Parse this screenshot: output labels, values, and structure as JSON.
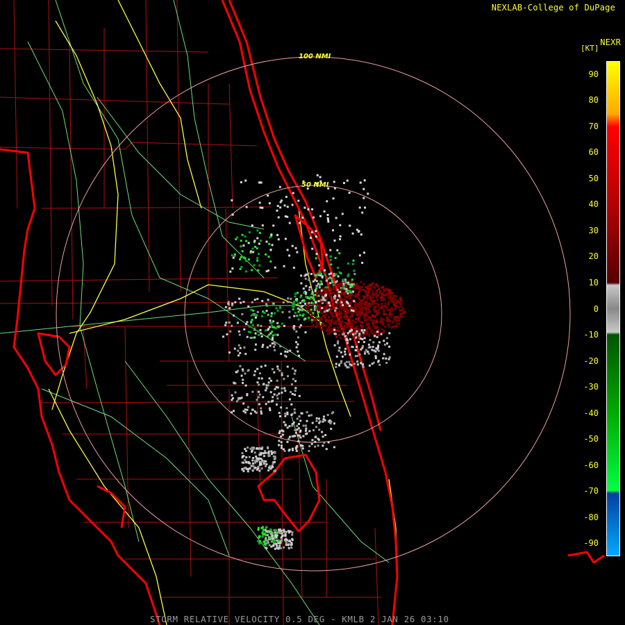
{
  "header": {
    "credit": "NEXLAB-College of DuPage",
    "product": "NEXR",
    "units": "[KT]"
  },
  "rings": {
    "outer_label": "100 NMI",
    "inner_label": "50 NMI"
  },
  "footer": {
    "caption": "STORM RELATIVE VELOCITY 0.5 DEG - KMLB 2 JAN 26 03:10"
  },
  "legend": {
    "ticks": [
      "90",
      "80",
      "70",
      "60",
      "50",
      "40",
      "30",
      "20",
      "10",
      "0",
      "-10",
      "-20",
      "-30",
      "-40",
      "-50",
      "-60",
      "-70",
      "-80",
      "-90"
    ],
    "range_kt": [
      -95,
      95
    ],
    "color_stops": [
      {
        "kt": 95,
        "color": "#ffff00"
      },
      {
        "kt": 75,
        "color": "#ffaa00"
      },
      {
        "kt": 70,
        "color": "#ff0000"
      },
      {
        "kt": 40,
        "color": "#b40000"
      },
      {
        "kt": 10,
        "color": "#550000"
      },
      {
        "kt": 9,
        "color": "#c8c8c8"
      },
      {
        "kt": 0,
        "color": "#888888"
      },
      {
        "kt": -9,
        "color": "#c8c8c8"
      },
      {
        "kt": -10,
        "color": "#005500"
      },
      {
        "kt": -40,
        "color": "#00aa00"
      },
      {
        "kt": -70,
        "color": "#00ff44"
      },
      {
        "kt": -71,
        "color": "#0040a0"
      },
      {
        "kt": -95,
        "color": "#00aaff"
      }
    ]
  },
  "colors": {
    "background": "#000000",
    "coastline": "#ff0000",
    "county_lines": "#b01010",
    "highways": "#ffff44",
    "roads": "#6ee07a",
    "range_rings": "#f0a0a0",
    "label_text": "#ffff33"
  }
}
